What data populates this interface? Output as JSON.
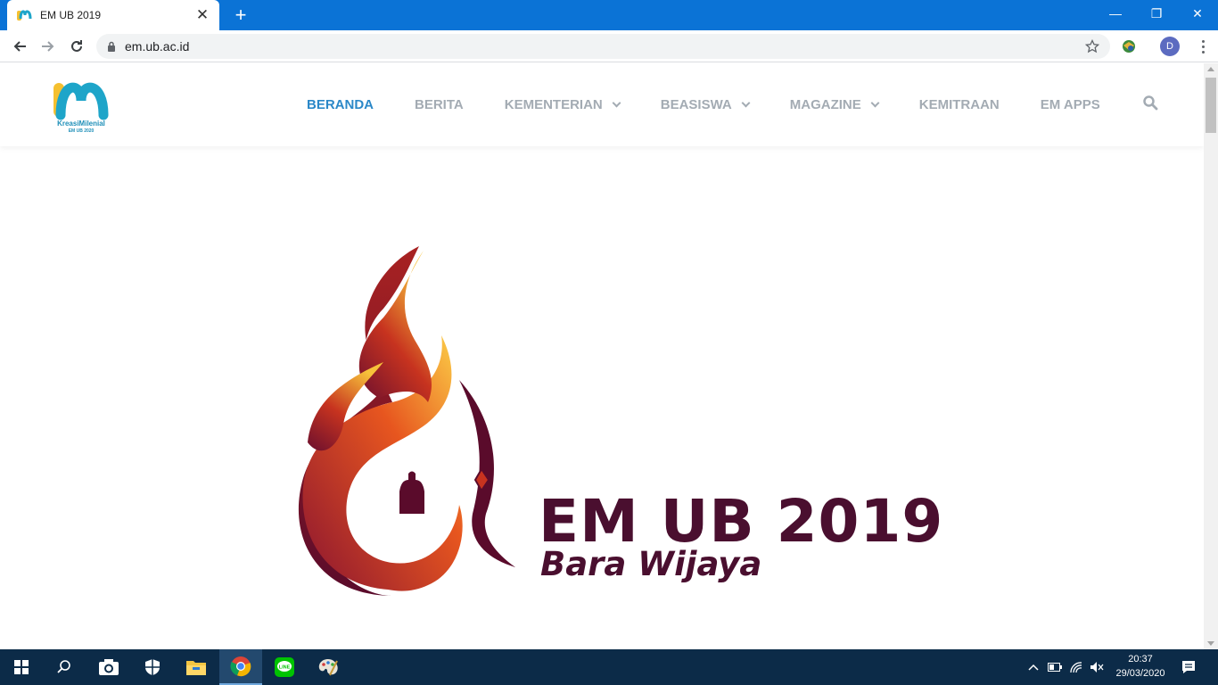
{
  "browser": {
    "tab_title": "EM UB 2019",
    "tab_close": "✕",
    "new_tab": "+",
    "url": "em.ub.ac.id",
    "profile_initial": "D",
    "window_controls": {
      "minimize": "—",
      "restore": "❐",
      "close": "✕"
    }
  },
  "site": {
    "logo_text": "KreasiMilenial",
    "logo_sub": "EM UB 2020",
    "nav": [
      {
        "label": "BERANDA",
        "active": true
      },
      {
        "label": "BERITA"
      },
      {
        "label": "KEMENTERIAN",
        "dropdown": true
      },
      {
        "label": "BEASISWA",
        "dropdown": true
      },
      {
        "label": "MAGAZINE",
        "dropdown": true
      },
      {
        "label": "KEMITRAAN"
      },
      {
        "label": "EM APPS"
      }
    ],
    "hero_title": "EM UB 2019",
    "hero_subtitle": "Bara Wijaya"
  },
  "taskbar": {
    "time": "20:37",
    "date": "29/03/2020"
  },
  "colors": {
    "accent_nav": "#2b88c8",
    "hero_text": "#4a0f2f",
    "chrome_blue": "#0b73d6",
    "taskbar": "#0c2b48"
  }
}
